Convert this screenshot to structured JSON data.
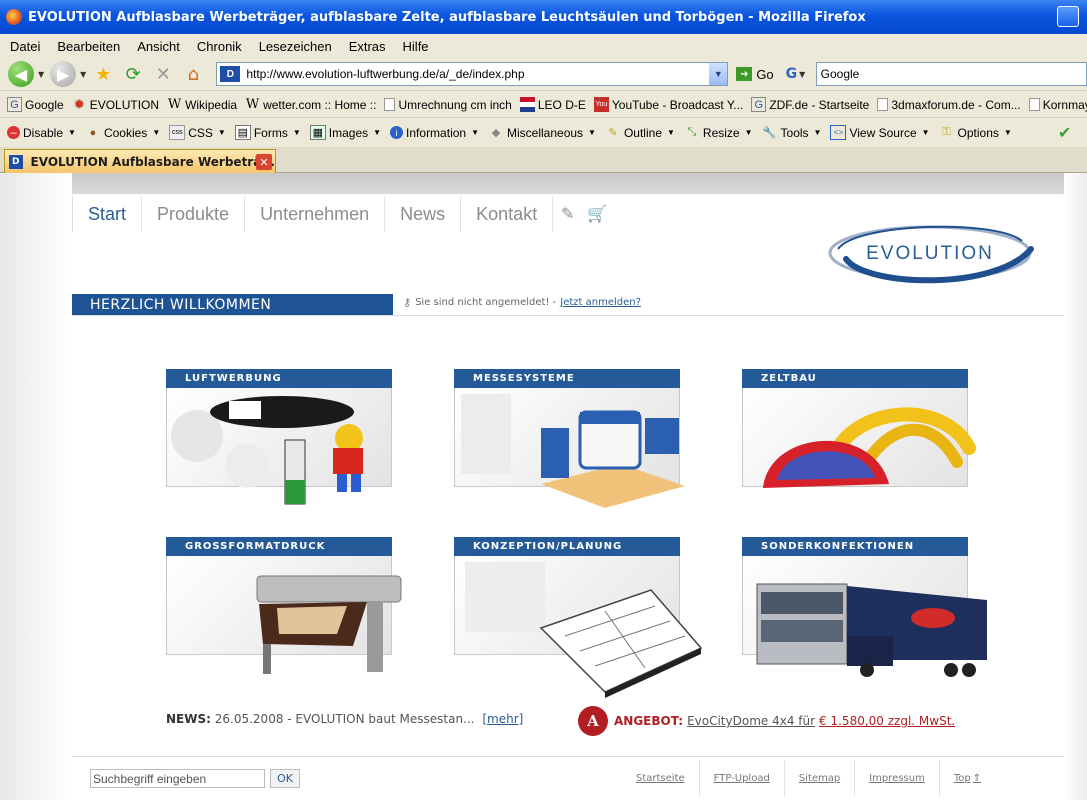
{
  "window": {
    "title": "EVOLUTION Aufblasbare Werbeträger, aufblasbare Zelte, aufblasbare Leuchtsäulen und Torbögen - Mozilla Firefox"
  },
  "menu": [
    "Datei",
    "Bearbeiten",
    "Ansicht",
    "Chronik",
    "Lesezeichen",
    "Extras",
    "Hilfe"
  ],
  "navigation": {
    "url": "http://www.evolution-luftwerbung.de/a/_de/index.php",
    "go_label": "Go",
    "search_value": "Google"
  },
  "bookmarks": [
    {
      "label": "Google",
      "icon": "google-icon"
    },
    {
      "label": "EVOLUTION",
      "icon": "gear-icon"
    },
    {
      "label": "Wikipedia",
      "icon": "wikipedia-icon"
    },
    {
      "label": "wetter.com :: Home ::",
      "icon": "wikipedia-icon"
    },
    {
      "label": "Umrechnung cm inch",
      "icon": "page-icon"
    },
    {
      "label": "LEO D-E",
      "icon": "flag-icon"
    },
    {
      "label": "YouTube - Broadcast Y...",
      "icon": "youtube-icon"
    },
    {
      "label": "ZDF.de - Startseite",
      "icon": "google-icon"
    },
    {
      "label": "3dmaxforum.de - Com...",
      "icon": "page-icon"
    },
    {
      "label": "Kornmayer F",
      "icon": "page-icon"
    }
  ],
  "devtoolbar": [
    {
      "label": "Disable",
      "icon": "disable-icon"
    },
    {
      "label": "Cookies",
      "icon": "cookies-icon"
    },
    {
      "label": "CSS",
      "icon": "css-icon"
    },
    {
      "label": "Forms",
      "icon": "forms-icon"
    },
    {
      "label": "Images",
      "icon": "images-icon"
    },
    {
      "label": "Information",
      "icon": "information-icon"
    },
    {
      "label": "Miscellaneous",
      "icon": "miscellaneous-icon"
    },
    {
      "label": "Outline",
      "icon": "outline-icon"
    },
    {
      "label": "Resize",
      "icon": "resize-icon"
    },
    {
      "label": "Tools",
      "icon": "tools-icon"
    },
    {
      "label": "View Source",
      "icon": "view-source-icon"
    },
    {
      "label": "Options",
      "icon": "options-icon"
    }
  ],
  "tab": {
    "label": "EVOLUTION Aufblasbare Werbeträ..."
  },
  "site": {
    "nav": [
      "Start",
      "Produkte",
      "Unternehmen",
      "News",
      "Kontakt"
    ],
    "logo_text": "EVOLUTION",
    "welcome": "HERZLICH WILLKOMMEN",
    "login_text": "Sie sind nicht angemeldet! -",
    "login_link": "Jetzt anmelden?",
    "tiles": [
      {
        "title": "LUFTWERBUNG"
      },
      {
        "title": "MESSESYSTEME"
      },
      {
        "title": "ZELTBAU"
      },
      {
        "title": "GROSSFORMATDRUCK"
      },
      {
        "title": "KONZEPTION/PLANUNG"
      },
      {
        "title": "SONDERKONFEKTIONEN"
      }
    ],
    "news_label": "NEWS:",
    "news_text": "26.05.2008 - EVOLUTION baut Messestan...",
    "news_more": "[mehr]",
    "offer_badge": "A",
    "offer_label": "ANGEBOT:",
    "offer_text": "EvoCityDome 4x4 für",
    "offer_price": "€ 1.580,00 zzgl. MwSt.",
    "search_placeholder": "Suchbegriff eingeben",
    "search_ok": "OK",
    "footer_links": [
      "Startseite",
      "FTP-Upload",
      "Sitemap",
      "Impressum",
      "Top"
    ]
  },
  "colors": {
    "brand_blue": "#255a98",
    "offer_red": "#b31e23"
  }
}
